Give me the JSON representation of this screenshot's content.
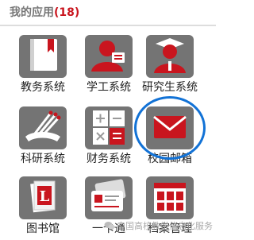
{
  "header": {
    "title": "我的应用",
    "count": "(18)"
  },
  "apps": [
    {
      "label": "教务系统",
      "icon": "book-bookmark-icon"
    },
    {
      "label": "学工系统",
      "icon": "user-id-card-icon"
    },
    {
      "label": "研究生系统",
      "icon": "graduate-user-icon"
    },
    {
      "label": "科研系统",
      "icon": "research-tools-icon"
    },
    {
      "label": "财务系统",
      "icon": "calculator-icon"
    },
    {
      "label": "校园邮箱",
      "icon": "envelope-icon"
    },
    {
      "label": "图书馆",
      "icon": "library-book-icon"
    },
    {
      "label": "一卡通",
      "icon": "id-card-icon"
    },
    {
      "label": "档案管理",
      "icon": "archive-icon"
    }
  ],
  "watermark": {
    "text": "中国高校教学信息化服务"
  },
  "colors": {
    "accent": "#c9151e",
    "icon_bg": "#747474",
    "highlight": "#1272d6"
  }
}
